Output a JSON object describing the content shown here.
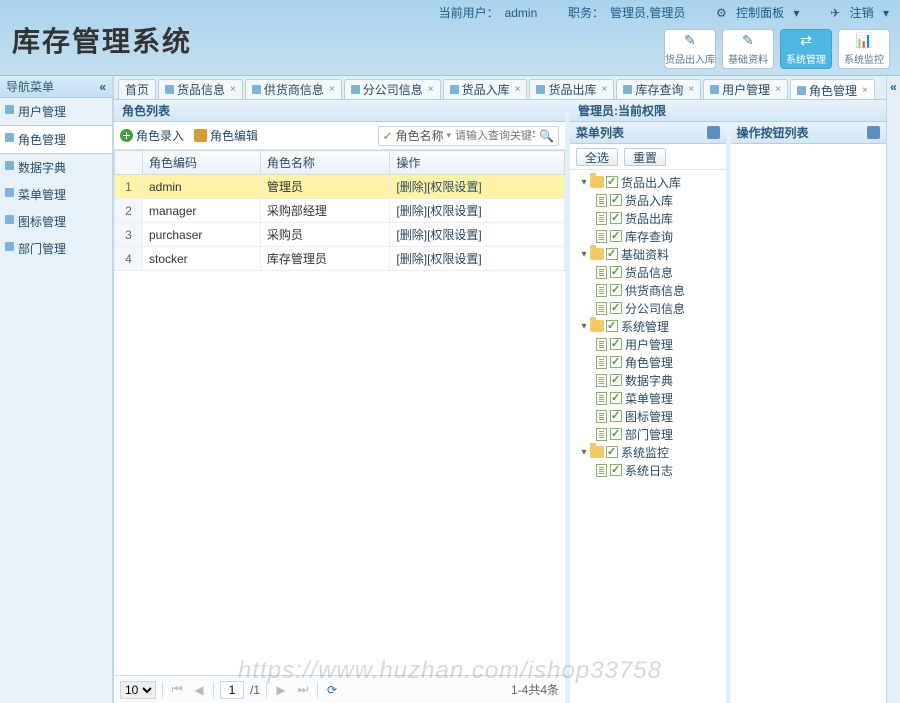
{
  "app": {
    "title": "库存管理系统"
  },
  "userbar": {
    "userLabel": "当前用户：",
    "user": "admin",
    "roleLabel": "职务：",
    "role": "管理员,管理员",
    "panel": "控制面板",
    "logout": "注销"
  },
  "modules": [
    {
      "label": "货品出入库",
      "icon": "✎"
    },
    {
      "label": "基础资料",
      "icon": "✎"
    },
    {
      "label": "系统管理",
      "icon": "⇄",
      "active": true
    },
    {
      "label": "系统监控",
      "icon": "📊"
    }
  ],
  "nav": {
    "title": "导航菜单",
    "items": [
      {
        "label": "用户管理"
      },
      {
        "label": "角色管理",
        "selected": true
      },
      {
        "label": "数据字典"
      },
      {
        "label": "菜单管理"
      },
      {
        "label": "图标管理"
      },
      {
        "label": "部门管理"
      }
    ]
  },
  "tabs": [
    {
      "label": "首页",
      "icon": false
    },
    {
      "label": "货品信息"
    },
    {
      "label": "供货商信息"
    },
    {
      "label": "分公司信息"
    },
    {
      "label": "货品入库"
    },
    {
      "label": "货品出库"
    },
    {
      "label": "库存查询"
    },
    {
      "label": "用户管理"
    },
    {
      "label": "角色管理",
      "active": true
    }
  ],
  "grid": {
    "title": "角色列表",
    "addBtn": "角色录入",
    "editBtn": "角色编辑",
    "searchField": "角色名称",
    "searchPlaceholder": "请输入查询关键字",
    "cols": [
      "角色编码",
      "角色名称",
      "操作"
    ],
    "rows": [
      {
        "n": 1,
        "code": "admin",
        "name": "管理员",
        "op": "[删除][权限设置]",
        "sel": true
      },
      {
        "n": 2,
        "code": "manager",
        "name": "采购部经理",
        "op": "[删除][权限设置]"
      },
      {
        "n": 3,
        "code": "purchaser",
        "name": "采购员",
        "op": "[删除][权限设置]"
      },
      {
        "n": 4,
        "code": "stocker",
        "name": "库存管理员",
        "op": "[删除][权限设置]"
      }
    ],
    "pager": {
      "size": "10",
      "page": "1",
      "total": "/1",
      "info": "1-4共4条"
    }
  },
  "perm": {
    "title": "管理员:当前权限",
    "menuTitle": "菜单列表",
    "btnTitle": "操作按钮列表",
    "selectAll": "全选",
    "reset": "重置",
    "tree": [
      {
        "label": "货品出入库",
        "children": [
          "货品入库",
          "货品出库",
          "库存查询"
        ]
      },
      {
        "label": "基础资料",
        "children": [
          "货品信息",
          "供货商信息",
          "分公司信息"
        ]
      },
      {
        "label": "系统管理",
        "children": [
          "用户管理",
          "角色管理",
          "数据字典",
          "菜单管理",
          "图标管理",
          "部门管理"
        ]
      },
      {
        "label": "系统监控",
        "children": [
          "系统日志"
        ]
      }
    ]
  },
  "watermark": "https://www.huzhan.com/ishop33758"
}
